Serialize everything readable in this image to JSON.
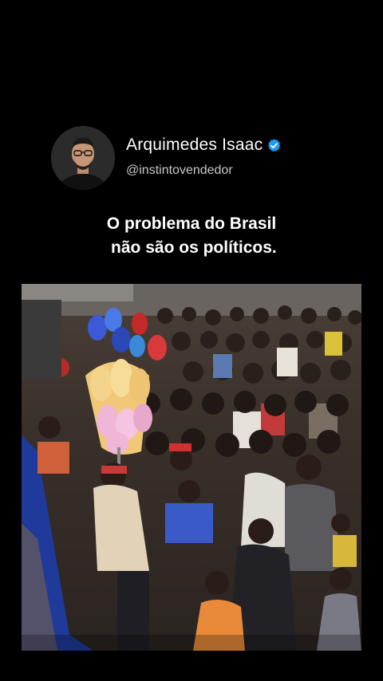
{
  "author": {
    "name": "Arquimedes Isaac",
    "handle": "@instintovendedor",
    "verified": true,
    "verified_badge_icon": "verified-badge-icon",
    "verified_color": "#1d9bf0"
  },
  "post": {
    "lines": [
      "O problema do Brasil",
      " não são os políticos."
    ]
  },
  "media": {
    "type": "video-still",
    "description_icon": "crowd-photo"
  },
  "colors": {
    "background": "#000000",
    "text": "#ffffff",
    "handle": "#c8c8c8"
  }
}
